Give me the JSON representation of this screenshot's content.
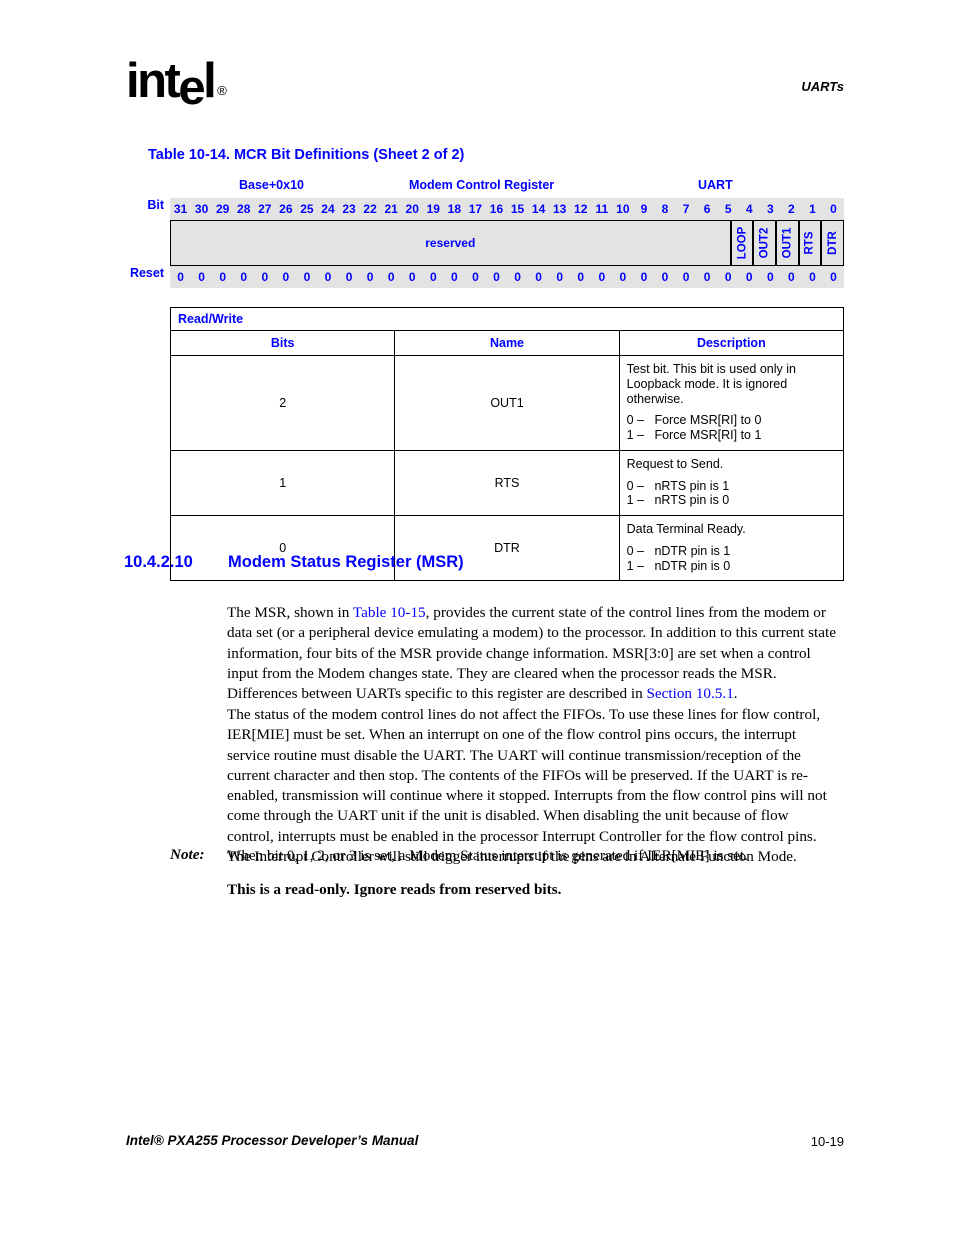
{
  "page": {
    "running_head": "UARTs",
    "logo_text_pre": "int",
    "logo_text_e": "e",
    "logo_text_post": "l",
    "logo_reg": "®",
    "footer_title": "Intel® PXA255 Processor Developer’s Manual",
    "footer_page": "10-19"
  },
  "table_caption": "Table 10-14. MCR Bit Definitions (Sheet 2 of 2)",
  "register": {
    "base_address": "Base+0x10",
    "register_name": "Modem Control Register",
    "unit": "UART",
    "bit_row_label": "Bit",
    "reset_row_label": "Reset",
    "bit_numbers": [
      "31",
      "30",
      "29",
      "28",
      "27",
      "26",
      "25",
      "24",
      "23",
      "22",
      "21",
      "20",
      "19",
      "18",
      "17",
      "16",
      "15",
      "14",
      "13",
      "12",
      "11",
      "10",
      "9",
      "8",
      "7",
      "6",
      "5",
      "4",
      "3",
      "2",
      "1",
      "0"
    ],
    "fields": [
      {
        "label": "reserved",
        "span": 27,
        "orientation": "horizontal"
      },
      {
        "label": "LOOP",
        "span": 1,
        "orientation": "vertical"
      },
      {
        "label": "OUT2",
        "span": 1,
        "orientation": "vertical"
      },
      {
        "label": "OUT1",
        "span": 1,
        "orientation": "vertical"
      },
      {
        "label": "RTS",
        "span": 1,
        "orientation": "vertical"
      },
      {
        "label": "DTR",
        "span": 1,
        "orientation": "vertical"
      }
    ],
    "reset_values": [
      "0",
      "0",
      "0",
      "0",
      "0",
      "0",
      "0",
      "0",
      "0",
      "0",
      "0",
      "0",
      "0",
      "0",
      "0",
      "0",
      "0",
      "0",
      "0",
      "0",
      "0",
      "0",
      "0",
      "0",
      "0",
      "0",
      "0",
      "0",
      "0",
      "0",
      "0",
      "0"
    ]
  },
  "desc_table": {
    "access": "Read/Write",
    "headers": {
      "bits": "Bits",
      "name": "Name",
      "description": "Description"
    },
    "rows": [
      {
        "bits": "2",
        "name": "OUT1",
        "lead": "Test bit. This bit is used only in Loopback mode. It is ignored otherwise.",
        "opt0": "0 –   Force MSR[RI] to 0",
        "opt1": "1 –   Force MSR[RI] to 1"
      },
      {
        "bits": "1",
        "name": "RTS",
        "lead": "Request to Send.",
        "opt0": "0 –   nRTS pin is 1",
        "opt1": "1 –   nRTS pin is 0"
      },
      {
        "bits": "0",
        "name": "DTR",
        "lead": "Data Terminal Ready.",
        "opt0": "0 –   nDTR pin is 1",
        "opt1": "1 –   nDTR pin is 0"
      }
    ]
  },
  "section": {
    "number": "10.4.2.10",
    "title": "Modem Status Register (MSR)",
    "para1_a": "The MSR, shown in ",
    "para1_xref1": "Table 10-15",
    "para1_b": ", provides the current state of the control lines from the modem or data set (or a peripheral device emulating a modem) to the processor. In addition to this current state information, four bits of the MSR provide change information. MSR[3:0] are set when a control input from the Modem changes state. They are cleared when the processor reads the MSR. Differences between UARTs specific to this register are described in ",
    "para1_xref2": "Section 10.5.1",
    "para1_c": ".",
    "para2": "The status of the modem control lines do not affect the FIFOs. To use these lines for flow control, IER[MIE] must be set. When an interrupt on one of the flow control pins occurs, the interrupt service routine must disable the UART. The UART will continue transmission/reception of the current character and then stop. The contents of the FIFOs will be preserved. If the UART is re-enabled, transmission will continue where it stopped. Interrupts from the flow control pins will not come through the UART unit if the unit is disabled. When disabling the unit because of flow control, interrupts must be enabled in the processor Interrupt Controller for the flow control pins. The Interrupt Controller will still trigger interrupts if the pins are in Alternate Function Mode.",
    "note_label": "Note:",
    "note_text": "When bit 0, 1, 2, or 3 is set, a Modem Status interrupt is generated if IER[MIE] is set.",
    "readonly_note": "This is a read-only. Ignore reads from reserved bits."
  },
  "colors": {
    "accent_blue": "#0000ff",
    "diagram_gray": "#e3e3e3",
    "text_black": "#000000"
  }
}
